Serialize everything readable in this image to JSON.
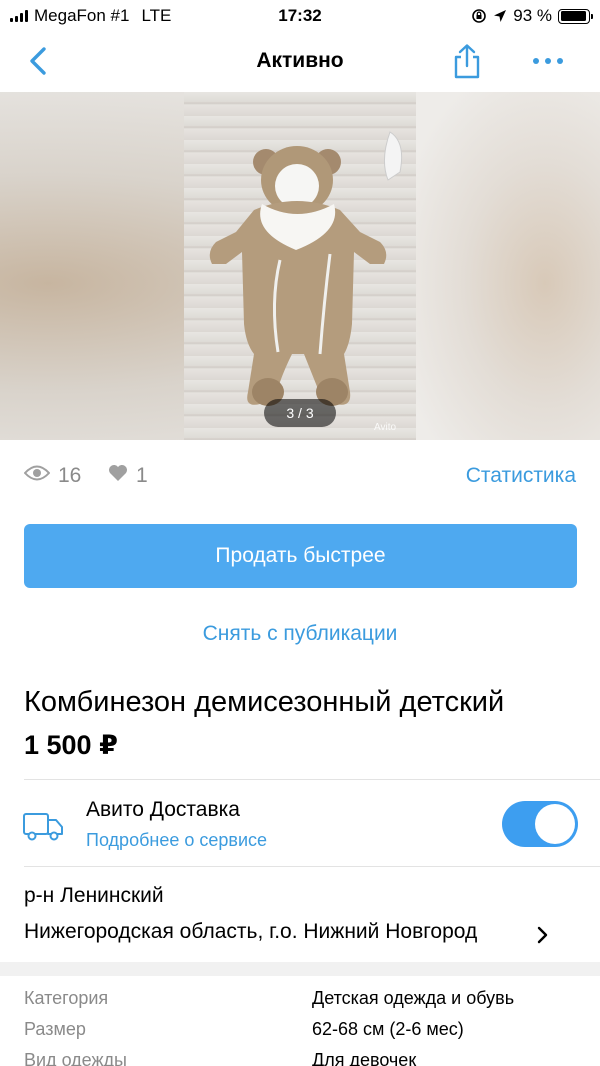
{
  "status_bar": {
    "carrier": "MegaFon #1",
    "network": "LTE",
    "time": "17:32",
    "battery": "93 %",
    "battery_level": 0.93
  },
  "nav": {
    "title": "Активно"
  },
  "gallery": {
    "counter": "3 / 3",
    "watermark": "Avito"
  },
  "stats": {
    "views": "16",
    "likes": "1",
    "statistics_link": "Статистика"
  },
  "actions": {
    "sell_faster": "Продать быстрее",
    "unpublish": "Снять с публикации"
  },
  "item": {
    "title": "Комбинезон демисезонный детский",
    "price": "1 500 ₽"
  },
  "delivery": {
    "title": "Авито Доставка",
    "link": "Подробнее о сервисе",
    "enabled": true
  },
  "location": {
    "district": "р-н Ленинский",
    "address": "Нижегородская область, г.о. Нижний Новгород"
  },
  "params": [
    {
      "key": "Категория",
      "value": "Детская одежда и обувь"
    },
    {
      "key": "Размер",
      "value": "62-68 см (2-6 мес)"
    },
    {
      "key": "Вид одежды",
      "value": "Для девочек"
    }
  ],
  "colors": {
    "accent": "#3b9bde",
    "button": "#4ea9f0",
    "toggle": "#3d9ef0",
    "muted": "#8a8a8a"
  }
}
